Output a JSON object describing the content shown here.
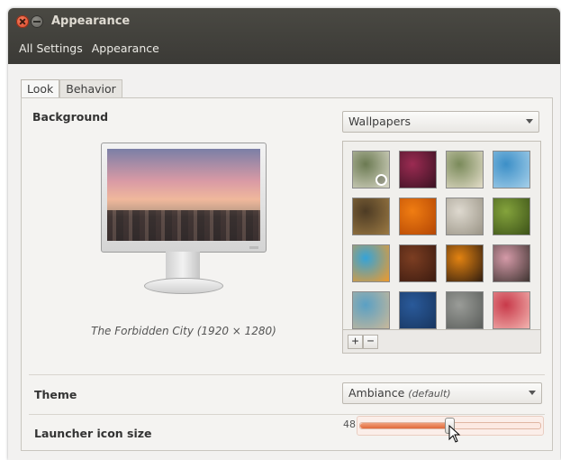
{
  "window": {
    "title": "Appearance"
  },
  "breadcrumb": [
    "All Settings",
    "Appearance"
  ],
  "tabs": [
    {
      "label": "Look",
      "active": true
    },
    {
      "label": "Behavior",
      "active": false
    }
  ],
  "background": {
    "label": "Background",
    "source_dropdown": {
      "selected": "Wallpapers"
    },
    "current_wallpaper": "The Forbidden City (1920 × 1280)",
    "thumbnails": [
      {
        "name": "succulent-clock",
        "colors": [
          "#6b7a52",
          "#d9d8c7"
        ],
        "has_clock": true
      },
      {
        "name": "pink-flower-macro",
        "colors": [
          "#9b2b52",
          "#3a1222"
        ]
      },
      {
        "name": "succulent-rosette",
        "colors": [
          "#7a8a5a",
          "#e3ddc9"
        ]
      },
      {
        "name": "birds-on-sky",
        "colors": [
          "#3c8fc7",
          "#a6d0ea"
        ]
      },
      {
        "name": "bokeh-dark",
        "colors": [
          "#4d3b24",
          "#9c7a43"
        ]
      },
      {
        "name": "orange-flower",
        "colors": [
          "#f07d12",
          "#b44604"
        ]
      },
      {
        "name": "white-feather",
        "colors": [
          "#ded9cf",
          "#9a9486"
        ]
      },
      {
        "name": "green-plant",
        "colors": [
          "#84a33c",
          "#3c5218"
        ]
      },
      {
        "name": "cartoon-bird",
        "colors": [
          "#35a3d8",
          "#f09a2a"
        ]
      },
      {
        "name": "brown-dot",
        "colors": [
          "#7c3e22",
          "#3c1b10"
        ]
      },
      {
        "name": "orange-curve",
        "colors": [
          "#e38311",
          "#301d10"
        ]
      },
      {
        "name": "forbidden-city",
        "colors": [
          "#d59aa8",
          "#3e3431"
        ]
      },
      {
        "name": "bicycle-blur",
        "colors": [
          "#5aa0c4",
          "#c8b89a"
        ]
      },
      {
        "name": "blue-stripes",
        "colors": [
          "#2a5a9a",
          "#17355f"
        ]
      },
      {
        "name": "gray-fog",
        "colors": [
          "#9a9c98",
          "#5a5d5a"
        ]
      },
      {
        "name": "red-bokeh",
        "colors": [
          "#c83a4a",
          "#f3b4b0"
        ]
      }
    ],
    "toolbar": {
      "add": "+",
      "remove": "−"
    }
  },
  "theme": {
    "label": "Theme",
    "selected": "Ambiance",
    "selected_note": "(default)"
  },
  "launcher": {
    "label": "Launcher icon size",
    "value": "48",
    "fraction": 0.5
  },
  "colors": {
    "titlebar": "#3c3b37",
    "accent": "#e8703f",
    "panel": "#f2f1f0"
  }
}
